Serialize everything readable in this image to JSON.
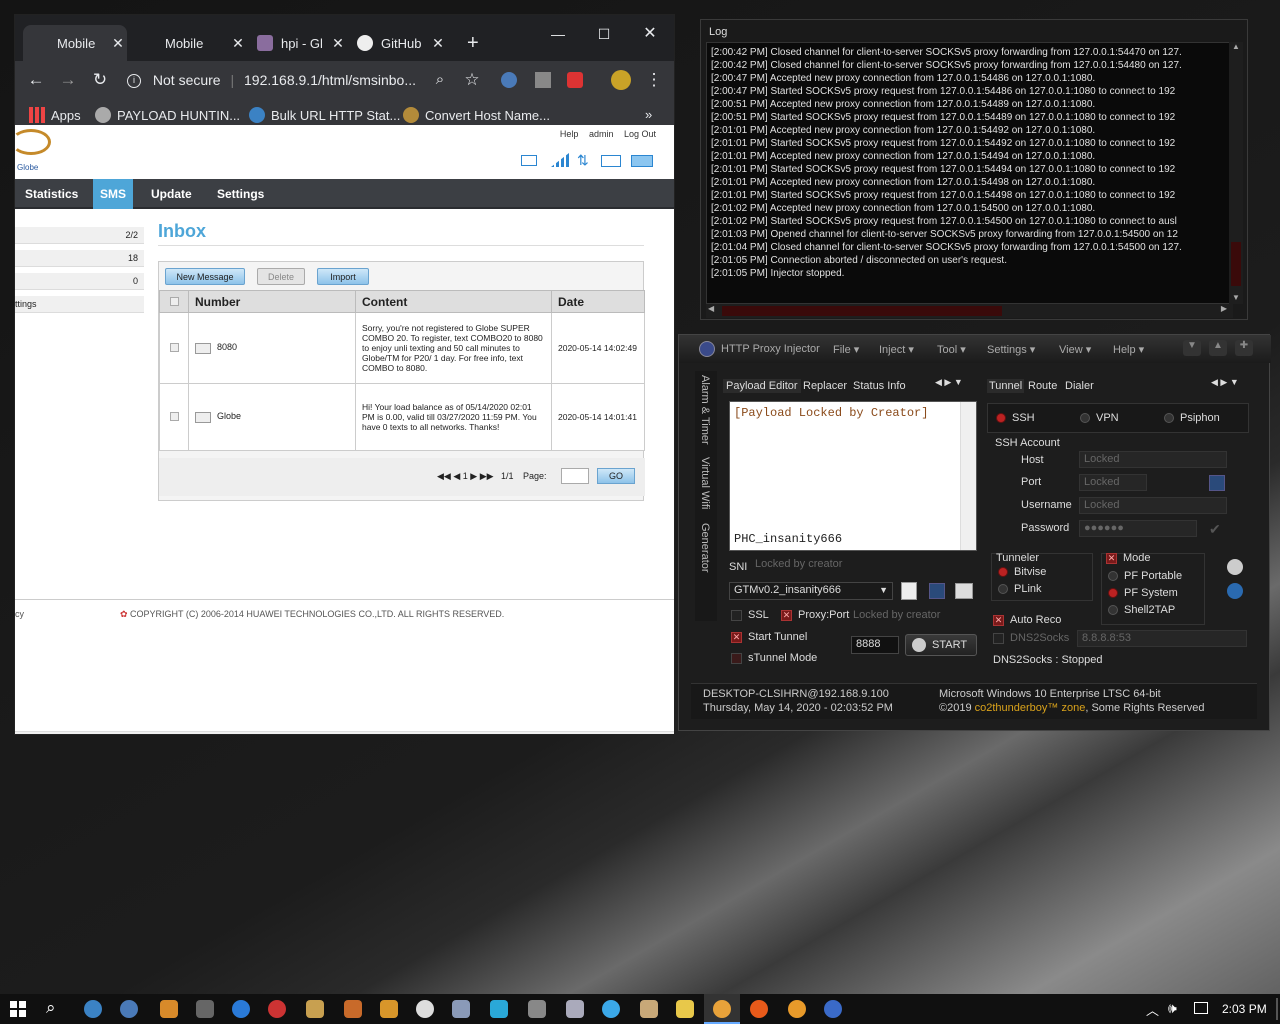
{
  "browser": {
    "tabs": [
      {
        "label": "Mobile "
      },
      {
        "label": "Mobile "
      },
      {
        "label": "hpi - Gl"
      },
      {
        "label": "GitHub"
      }
    ],
    "new_tab": "+",
    "security": "Not secure",
    "url": "192.168.9.1/html/smsinbo...",
    "bookmarks": [
      "Apps",
      "PAYLOAD HUNTIN...",
      "Bulk URL HTTP Stat...",
      "Convert Host Name..."
    ],
    "bookmarks_more": "»"
  },
  "router": {
    "logo_text": "Globe",
    "header_links": [
      "Help",
      "admin",
      "Log Out"
    ],
    "nav": [
      "Statistics",
      "SMS",
      "Update",
      "Settings"
    ],
    "left_rows": [
      "2/2",
      "18",
      "0",
      "ttings"
    ],
    "inbox_title": "Inbox",
    "buttons": {
      "new": "New Message",
      "delete": "Delete",
      "import": "Import"
    },
    "columns": [
      "Number",
      "Content",
      "Date"
    ],
    "messages": [
      {
        "number": "8080",
        "content": "Sorry, you're not registered to Globe SUPER COMBO 20. To register, text COMBO20 to 8080 to enjoy unli texting and 50 call minutes to Globe/TM for P20/ 1 day. For free info, text COMBO to 8080.",
        "date": "2020-05-14 14:02:49"
      },
      {
        "number": "Globe",
        "content": "Hi! Your load balance as of 05/14/2020 02:01 PM is 0.00, valid till 03/27/2020 11:59 PM. You have 0 texts to all networks. Thanks!",
        "date": "2020-05-14 14:01:41"
      }
    ],
    "pager": {
      "nav": "◀◀ ◀  1  ▶ ▶▶",
      "count": "1/1",
      "page_label": "Page:",
      "go": "GO"
    },
    "copyright": "COPYRIGHT (C) 2006-2014 HUAWEI TECHNOLOGIES CO.,LTD. ALL RIGHTS RESERVED.",
    "left_footer": "cy"
  },
  "log": {
    "title": "Log",
    "lines": [
      "[2:00:42 PM] Closed channel for client-to-server SOCKSv5 proxy forwarding from 127.0.0.1:54470 on 127.",
      "[2:00:42 PM] Closed channel for client-to-server SOCKSv5 proxy forwarding from 127.0.0.1:54480 on 127.",
      "[2:00:47 PM] Accepted new proxy connection from 127.0.0.1:54486 on 127.0.0.1:1080.",
      "[2:00:47 PM] Started SOCKSv5 proxy request from 127.0.0.1:54486 on 127.0.0.1:1080 to connect to 192",
      "[2:00:51 PM] Accepted new proxy connection from 127.0.0.1:54489 on 127.0.0.1:1080.",
      "[2:00:51 PM] Started SOCKSv5 proxy request from 127.0.0.1:54489 on 127.0.0.1:1080 to connect to 192",
      "[2:01:01 PM] Accepted new proxy connection from 127.0.0.1:54492 on 127.0.0.1:1080.",
      "[2:01:01 PM] Started SOCKSv5 proxy request from 127.0.0.1:54492 on 127.0.0.1:1080 to connect to 192",
      "[2:01:01 PM] Accepted new proxy connection from 127.0.0.1:54494 on 127.0.0.1:1080.",
      "[2:01:01 PM] Started SOCKSv5 proxy request from 127.0.0.1:54494 on 127.0.0.1:1080 to connect to 192",
      "[2:01:01 PM] Accepted new proxy connection from 127.0.0.1:54498 on 127.0.0.1:1080.",
      "[2:01:01 PM] Started SOCKSv5 proxy request from 127.0.0.1:54498 on 127.0.0.1:1080 to connect to 192",
      "[2:01:02 PM] Accepted new proxy connection from 127.0.0.1:54500 on 127.0.0.1:1080.",
      "[2:01:02 PM] Started SOCKSv5 proxy request from 127.0.0.1:54500 on 127.0.0.1:1080 to connect to ausl",
      "[2:01:03 PM] Opened channel for client-to-server SOCKSv5 proxy forwarding from 127.0.0.1:54500 on 12",
      "[2:01:04 PM] Closed channel for client-to-server SOCKSv5 proxy forwarding from 127.0.0.1:54500 on 127.",
      "[2:01:05 PM] Connection aborted / disconnected on user's request.",
      "[2:01:05 PM] Injector stopped."
    ]
  },
  "hpi": {
    "title": "HTTP Proxy Injector",
    "menus": [
      "File ▾",
      "Inject ▾",
      "Tool ▾",
      "Settings ▾",
      "View ▾",
      "Help ▾"
    ],
    "side_tabs": [
      "Alarm & Timer",
      "Virtual Wifi",
      "Generator"
    ],
    "left_tabs": [
      "Payload Editor",
      "Replacer",
      "Status Info"
    ],
    "right_tabs": [
      "Tunnel",
      "Route",
      "Dialer"
    ],
    "payload_locked": "[Payload Locked by Creator]",
    "payload_user": "PHC_insanity666",
    "sni_label": "SNI",
    "sni_value": "Locked by creator",
    "config": "GTMv0.2_insanity666",
    "ssl": "SSL",
    "proxy_port": "Proxy:Port",
    "proxy_value": "Locked by creator",
    "start_tunnel": "Start Tunnel",
    "port": "8888",
    "start": "START",
    "stunnel": "sTunnel Mode",
    "modes": [
      "SSH",
      "VPN",
      "Psiphon"
    ],
    "ssh_account": "SSH Account",
    "account_fields": [
      {
        "label": "Host",
        "value": "Locked"
      },
      {
        "label": "Port",
        "value": "Locked"
      },
      {
        "label": "Username",
        "value": "Locked"
      },
      {
        "label": "Password",
        "value": "●●●●●●"
      }
    ],
    "tunneler": "Tunneler",
    "tunneler_opts": [
      "Bitvise",
      "PLink"
    ],
    "mode": "Mode",
    "mode_opts": [
      "PF Portable",
      "PF System",
      "Shell2TAP"
    ],
    "auto_reco": "Auto Reco",
    "dns2socks": "DNS2Socks",
    "dns_value": "8.8.8.8:53",
    "dns_status": "DNS2Socks : Stopped",
    "status_host": "DESKTOP-CLSIHRN@192.168.9.100",
    "status_date": "Thursday, May 14, 2020 - 02:03:52 PM",
    "status_os": "Microsoft Windows 10 Enterprise LTSC 64-bit",
    "status_copy_prefix": "©2019 ",
    "status_copy_brand": "co2thunderboy™ zone",
    "status_copy_suffix": ", Some Rights Reserved"
  },
  "taskbar": {
    "time": "2:03 PM"
  }
}
